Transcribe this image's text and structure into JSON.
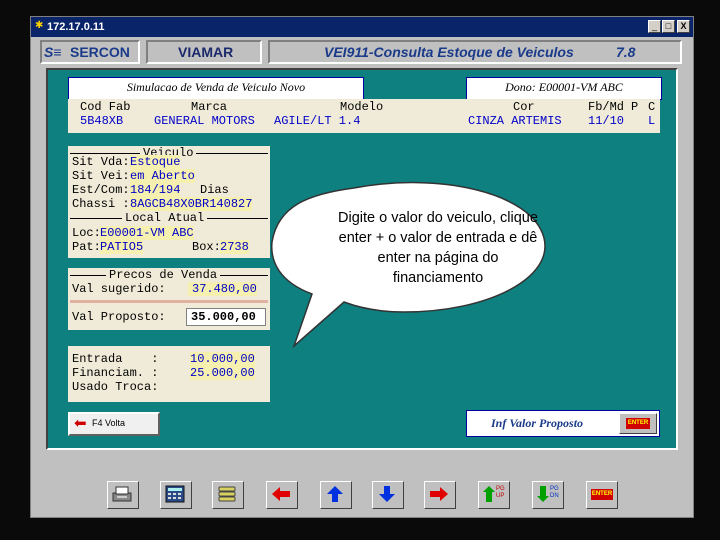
{
  "window": {
    "title": "172.17.0.11",
    "minimize": "_",
    "maximize": "□",
    "close": "X"
  },
  "header": {
    "brand": "SERCON",
    "module": "VIAMAR",
    "screen": "VEI911-Consulta Estoque de Veiculos",
    "version": "7.8"
  },
  "simulation": {
    "title": "Simulacao de Venda de Veiculo Novo",
    "owner": "Dono: E00001-VM ABC"
  },
  "vehicle_table": {
    "headers": {
      "cod_fab": "Cod Fab",
      "marca": "Marca",
      "modelo": "Modelo",
      "cor": "Cor",
      "fb_md": "Fb/Md",
      "p": "P",
      "c": "C"
    },
    "row": {
      "cod_fab": "5B48XB",
      "marca": "GENERAL MOTORS",
      "modelo": "AGILE/LT 1.4",
      "cor": "CINZA ARTEMIS",
      "fb_md": "11/10",
      "p": "",
      "c": "L"
    }
  },
  "veiculo": {
    "title": "Veiculo",
    "sit_vda_label": "Sit Vda:",
    "sit_vda": "Estoque",
    "sit_vei_label": "Sit Vei:",
    "sit_vei": "em Aberto",
    "est_com_label": "Est/Com:",
    "est_com": "184/194",
    "dias": "Dias",
    "chassi_label": "Chassi :",
    "chassi": "8AGCB48X0BR140827",
    "local_title": "Local Atual",
    "loc_label": "Loc:",
    "loc": "E00001-VM ABC",
    "pat_label": "Pat:",
    "pat": "PATIO5",
    "box_label": "Box:",
    "box": "2738"
  },
  "precos": {
    "title": "Precos de Venda",
    "sugerido_label": "Val sugerido:",
    "sugerido": "37.480,00",
    "proposto_label": "Val Proposto:",
    "proposto": "35.000,00"
  },
  "financiamento": {
    "entrada_label": "Entrada    :",
    "entrada": "10.000,00",
    "financ_label": "Financiam. :",
    "financ": "25.000,00",
    "troca_label": "Usado Troca:",
    "troca": ""
  },
  "callout": {
    "text": "Digite o valor do veiculo, clique enter + o valor de entrada e dê enter na página do financiamento"
  },
  "buttons": {
    "volta": "F4 Volta",
    "status": "Inf Valor Proposto",
    "enter": "ENTER"
  },
  "toolbar": {
    "pgup": "PG UP",
    "pgdn": "PG DN",
    "enter": "ENTER"
  },
  "colors": {
    "teal": "#0e8080",
    "panel": "#f0ebd8",
    "blue_text": "#0000c8",
    "title_blue": "#0a246a"
  }
}
